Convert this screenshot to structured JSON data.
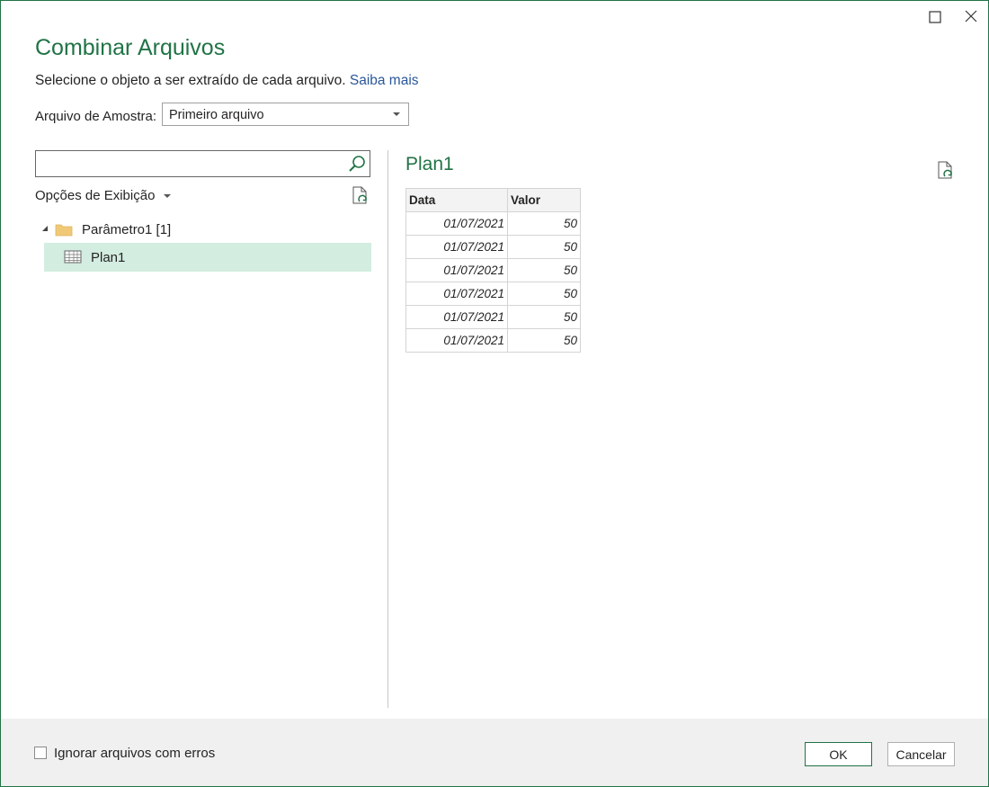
{
  "dialog": {
    "title": "Combinar Arquivos",
    "subtitle": "Selecione o objeto a ser extraído de cada arquivo.",
    "learn_more": "Saiba mais",
    "sample_label": "Arquivo de Amostra:",
    "sample_value": "Primeiro arquivo"
  },
  "navigator": {
    "search_value": "",
    "view_options": "Opções de Exibição",
    "folder_label": "Parâmetro1 [1]",
    "item_label": "Plan1"
  },
  "preview": {
    "title": "Plan1",
    "columns": [
      "Data",
      "Valor"
    ],
    "rows": [
      [
        "01/07/2021",
        "50"
      ],
      [
        "01/07/2021",
        "50"
      ],
      [
        "01/07/2021",
        "50"
      ],
      [
        "01/07/2021",
        "50"
      ],
      [
        "01/07/2021",
        "50"
      ],
      [
        "01/07/2021",
        "50"
      ]
    ]
  },
  "footer": {
    "ignore_errors_label": "Ignorar arquivos com erros",
    "ignore_errors_checked": false,
    "ok_label": "OK",
    "cancel_label": "Cancelar"
  },
  "colors": {
    "accent": "#217346",
    "link": "#2b579a",
    "selection": "#d3ede0",
    "footer_bg": "#f0f0f0"
  }
}
